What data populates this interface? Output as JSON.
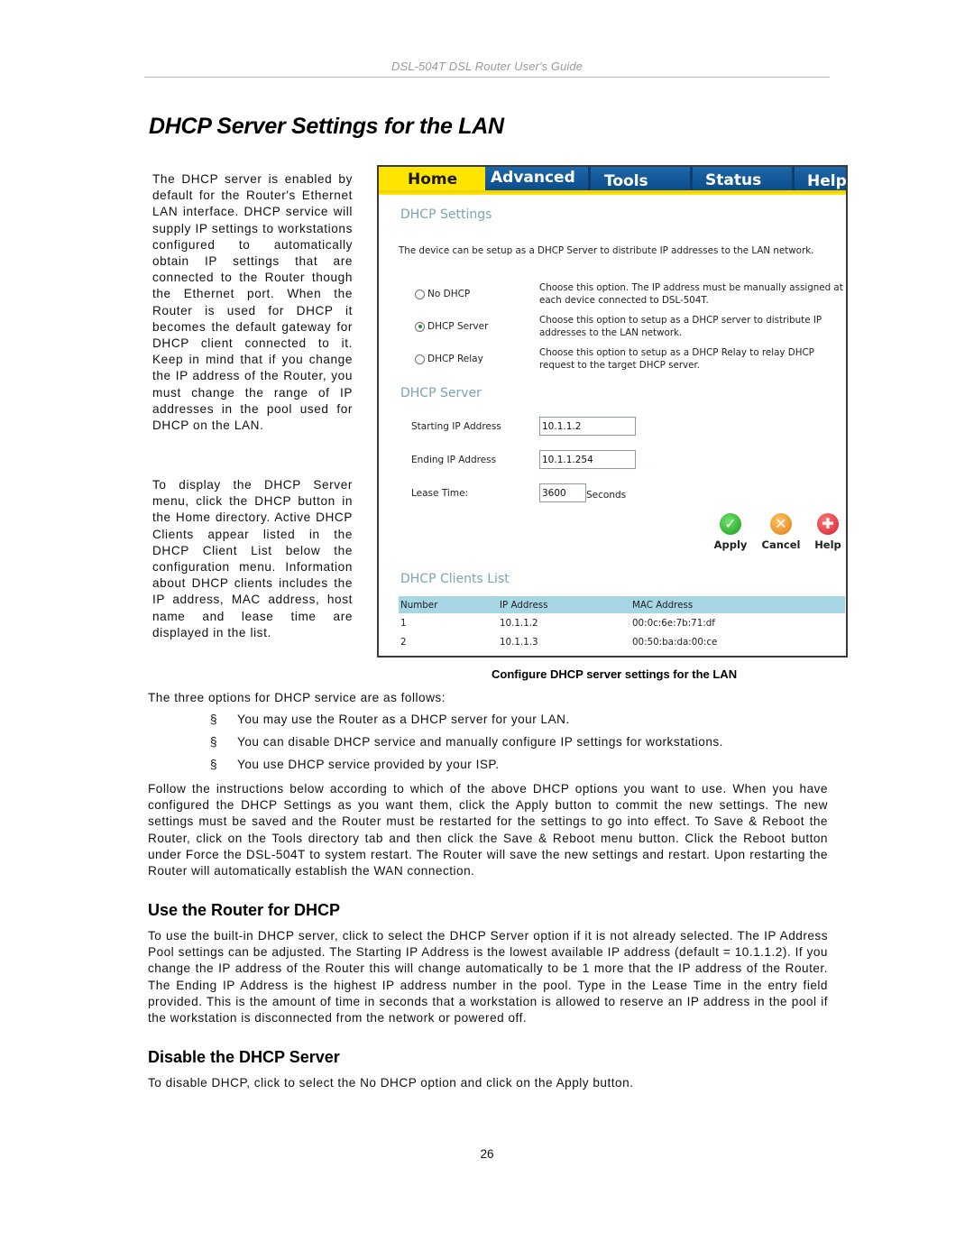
{
  "document": {
    "running_header": "DSL-504T DSL Router User's Guide",
    "title": "DHCP Server Settings for the LAN",
    "side_paragraphs": [
      "The DHCP server is enabled by default for the Router's Ethernet LAN interface. DHCP service will supply IP settings to workstations configured to automatically obtain IP settings that are connected to the Router though the Ethernet port. When the Router is used for DHCP it becomes the default gateway for DHCP client connected to it. Keep in mind that if you change the IP address of the Router, you must change the range of IP addresses in the pool used for DHCP on the LAN.",
      "To display the DHCP Server menu, click the DHCP button in the Home directory. Active DHCP Clients appear listed in the DHCP Client List below the configuration menu. Information about DHCP clients includes the IP address, MAC address, host name and lease time are displayed in the list."
    ],
    "figure_caption": "Configure DHCP server settings for the LAN",
    "intro": "The three options for DHCP service are as follows:",
    "bullet_mark": "§",
    "bullets": [
      "You may use the Router as a DHCP server for your LAN.",
      "You can disable DHCP service and manually configure IP settings for workstations.",
      "You use DHCP service provided by your ISP."
    ],
    "follow_paragraph": "Follow the instructions below according to which of the above DHCP options you want to use. When you have configured the DHCP Settings as you want them, click the Apply button to commit the new settings. The new settings must be saved and the Router must be restarted for the settings to go into effect. To Save & Reboot the Router, click on the Tools directory tab and then click the Save & Reboot menu button. Click the Reboot button under Force the DSL-504T to system restart. The Router will save the new settings and restart. Upon restarting the Router will automatically establish the WAN connection.",
    "section_use": {
      "heading": "Use the Router for DHCP",
      "body": "To use the built-in DHCP server, click to select the DHCP Server option if it is not already selected. The IP Address Pool settings can be adjusted. The Starting IP Address is the lowest available IP address (default = 10.1.1.2). If you change the IP address of the Router this will change automatically to be 1 more that the IP address of the Router. The Ending IP Address is the highest IP address number in the pool. Type in the Lease Time in the entry field provided. This is the amount of time in seconds that a workstation is allowed to reserve an IP address in the pool if the workstation is disconnected from the network or powered off."
    },
    "section_disable": {
      "heading": "Disable the DHCP Server",
      "body": "To disable DHCP, click to select the No DHCP option and click on the Apply button."
    },
    "page_number": "26"
  },
  "router_ui": {
    "tabs": [
      "Home",
      "Advanced",
      "Tools",
      "Status",
      "Help"
    ],
    "active_tab": "Home",
    "colors": {
      "tab_active": "#ffe400",
      "tab_inactive": "#15599a",
      "section_heading": "#7aa3b6",
      "table_header": "#a6d6e3"
    },
    "settings": {
      "heading": "DHCP Settings",
      "description": "The device can be setup as a DHCP Server to distribute IP addresses to the LAN network.",
      "options": [
        {
          "label": "No DHCP",
          "selected": false,
          "description": "Choose this option. The IP address must be manually assigned at each device connected to DSL-504T."
        },
        {
          "label": "DHCP Server",
          "selected": true,
          "description": "Choose this option to setup as a DHCP server to distribute IP addresses to the LAN network."
        },
        {
          "label": "DHCP Relay",
          "selected": false,
          "description": "Choose this option to setup as a DHCP Relay to relay DHCP request to the target DHCP server."
        }
      ]
    },
    "server": {
      "heading": "DHCP Server",
      "starting_ip_label": "Starting IP Address",
      "starting_ip_value": "10.1.1.2",
      "ending_ip_label": "Ending IP Address",
      "ending_ip_value": "10.1.1.254",
      "lease_time_label": "Lease Time:",
      "lease_time_value": "3600",
      "lease_time_unit": "Seconds"
    },
    "actions": [
      {
        "label": "Apply",
        "icon": "check-icon",
        "glyph": "✓"
      },
      {
        "label": "Cancel",
        "icon": "x-icon",
        "glyph": "✕"
      },
      {
        "label": "Help",
        "icon": "plus-icon",
        "glyph": "✚"
      }
    ],
    "clients": {
      "heading": "DHCP Clients List",
      "columns": [
        "Number",
        "IP Address",
        "MAC Address"
      ],
      "rows": [
        [
          "1",
          "10.1.1.2",
          "00:0c:6e:7b:71:df"
        ],
        [
          "2",
          "10.1.1.3",
          "00:50:ba:da:00:ce"
        ]
      ]
    }
  }
}
